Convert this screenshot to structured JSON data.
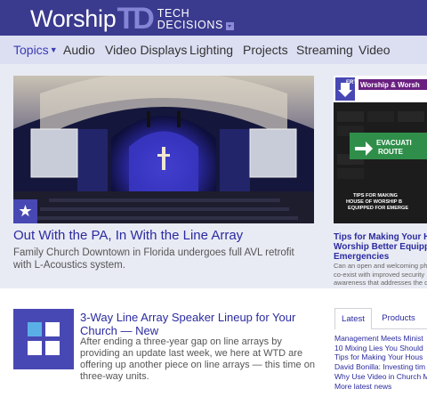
{
  "header": {
    "logo_word": "Worship",
    "logo_mark": "TD",
    "logo_line1": "TECH",
    "logo_line2": "DECISIONS"
  },
  "nav": {
    "items": [
      {
        "label": "Topics",
        "has_dropdown": true
      },
      {
        "label": "Audio"
      },
      {
        "label": "Video Displays"
      },
      {
        "label": "Lighting"
      },
      {
        "label": "Projects"
      },
      {
        "label": "Streaming"
      },
      {
        "label": "Video"
      }
    ]
  },
  "hero": {
    "title": "Out With the PA, In With the Line Array",
    "description": "Family Church Downtown in Florida undergoes full AVL retrofit with L-Acoustics system.",
    "badge_icon": "star-icon"
  },
  "sidebar_feature": {
    "image_banner_left": "ERT ES",
    "image_banner_right": "Worship & Worsh",
    "sign_text_1": "EVACUATI",
    "sign_text_2": "ROUTE",
    "image_caption": "TIPS FOR MAKING HOUSE OF WORSHIP B EQUIPPED FOR EMERGE",
    "title": "Tips for Making Your Ho Worship Better Equippe Emergencies",
    "description": "Can an open and welcoming ph co-exist with improved security awareness that addresses the d"
  },
  "article": {
    "title": "3-Way Line Array Speaker Lineup for Your Church — New",
    "description": "After ending a three-year gap on line arrays by providing an update last week, we here at WTD are offering up another piece on line arrays — this time on three-way units."
  },
  "tabs": {
    "latest": "Latest",
    "products": "Products"
  },
  "latest_list": [
    "Management Meets Minist",
    "10 Mixing Lies You Should",
    "Tips for Making Your Hous",
    "David Bonilla: Investing tim",
    "Why Use Video in Church M",
    "More latest news"
  ],
  "colors": {
    "brand": "#3a3a8f",
    "accent": "#4848b4",
    "link": "#2b2ba0"
  }
}
